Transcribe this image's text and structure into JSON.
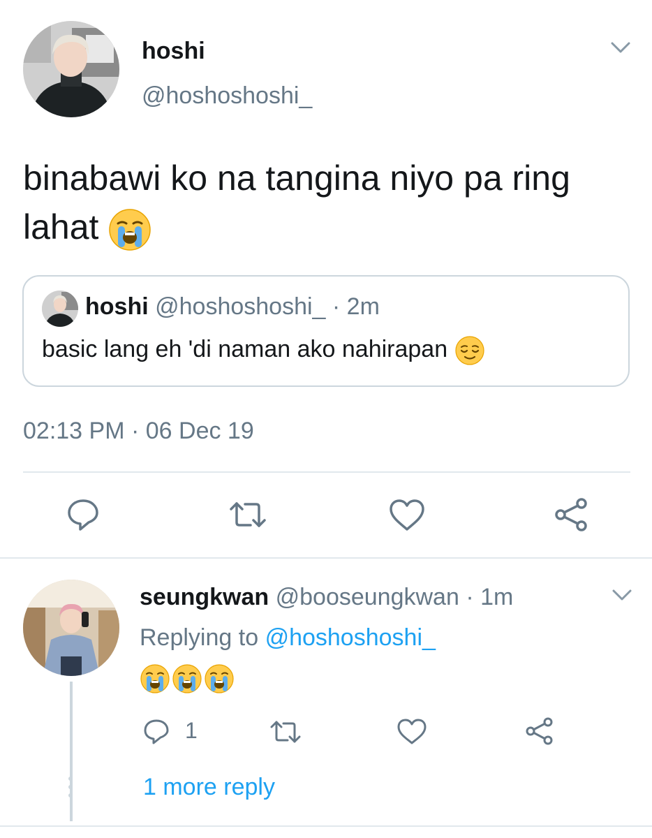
{
  "main_tweet": {
    "author": {
      "display_name": "hoshi",
      "handle": "@hoshoshoshi_"
    },
    "text": "binabawi ko na tangina niyo pa ring lahat",
    "text_emoji": "loudly-crying-face",
    "quoted_tweet": {
      "display_name": "hoshi",
      "meta": "@hoshoshoshi_ · 2m",
      "text": "basic lang eh 'di naman ako nahirapan",
      "text_emoji": "relieved-face"
    },
    "timestamp": "02:13 PM · 06 Dec 19",
    "actions": [
      "reply-icon",
      "retweet-icon",
      "like-icon",
      "share-icon"
    ]
  },
  "reply": {
    "display_name": "seungkwan",
    "meta": "@booseungkwan · 1m",
    "replying_to_label": "Replying to",
    "replying_to_handle": "@hoshoshoshi_",
    "emojis": [
      "loudly-crying-face",
      "loudly-crying-face",
      "loudly-crying-face"
    ],
    "reply_count": "1",
    "more_replies": "1 more reply"
  },
  "colors": {
    "text_primary": "#14171a",
    "text_secondary": "#657786",
    "link": "#1da1f2",
    "border": "#e1e8ed"
  }
}
